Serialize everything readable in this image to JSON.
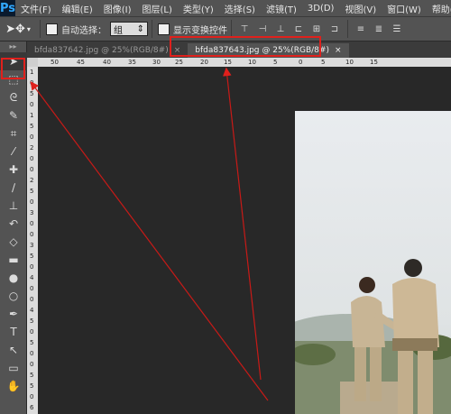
{
  "app": {
    "logo": "Ps"
  },
  "menu": [
    "文件(F)",
    "编辑(E)",
    "图像(I)",
    "图层(L)",
    "类型(Y)",
    "选择(S)",
    "滤镜(T)",
    "3D(D)",
    "视图(V)",
    "窗口(W)",
    "帮助(H)"
  ],
  "options": {
    "auto_select_label": "自动选择：",
    "auto_select_value": "组",
    "show_transform_label": "显示变换控件"
  },
  "tabs": [
    {
      "label": "bfda837642.jpg @ 25%(RGB/8#)",
      "close": "×",
      "active": false
    },
    {
      "label": "bfda837643.jpg @ 25%(RGB/8#)",
      "close": "×",
      "active": true
    }
  ],
  "ruler_top": [
    "50",
    "45",
    "40",
    "35",
    "30",
    "25",
    "20",
    "15",
    "10",
    "5",
    "0",
    "5",
    "10",
    "15"
  ],
  "ruler_left": [
    "1",
    "0",
    "5",
    "0",
    "1",
    "5",
    "0",
    "2",
    "0",
    "0",
    "2",
    "5",
    "0",
    "3",
    "0",
    "0",
    "3",
    "5",
    "0",
    "4",
    "0",
    "0",
    "4",
    "5",
    "0",
    "5",
    "0",
    "0",
    "5",
    "5",
    "0",
    "6"
  ],
  "tools": [
    "move-tool",
    "marquee-tool",
    "lasso-tool",
    "quick-select-tool",
    "crop-tool",
    "eyedropper-tool",
    "healing-brush-tool",
    "brush-tool",
    "clone-stamp-tool",
    "history-brush-tool",
    "eraser-tool",
    "gradient-tool",
    "blur-tool",
    "dodge-tool",
    "pen-tool",
    "type-tool",
    "path-select-tool",
    "rectangle-tool",
    "hand-tool"
  ],
  "colors": {
    "annotation": "#e0201c",
    "accent": "#31a8ff"
  }
}
